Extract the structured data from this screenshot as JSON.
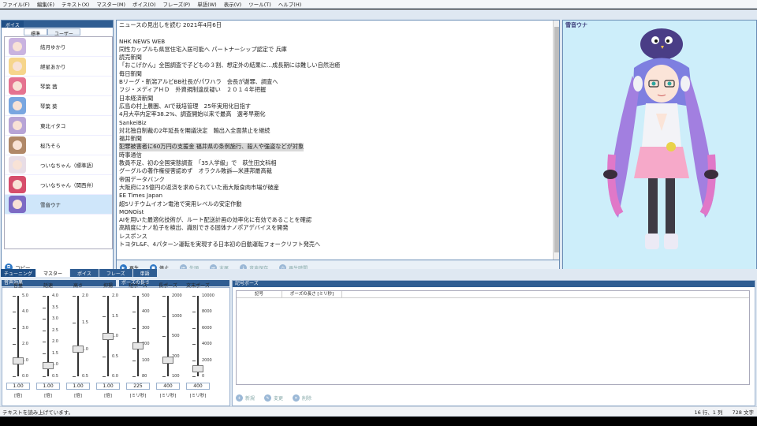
{
  "menu": [
    "ファイル(F)",
    "編集(E)",
    "テキスト(X)",
    "マスター(M)",
    "ボイス(O)",
    "フレーズ(P)",
    "単語(W)",
    "表示(V)",
    "ツール(T)",
    "ヘルプ(H)"
  ],
  "voice_panel": {
    "tabs": [
      "ボイス",
      "標準",
      "ユーザー"
    ],
    "items": [
      {
        "name": "結月ゆかり",
        "color": "#c9b3e0"
      },
      {
        "name": "紲星あかり",
        "color": "#f6d58b"
      },
      {
        "name": "琴葉 茜",
        "color": "#e57390"
      },
      {
        "name": "琴葉 葵",
        "color": "#79a6e0"
      },
      {
        "name": "東北イタコ",
        "color": "#b7a4d6"
      },
      {
        "name": "桜乃そら",
        "color": "#b08868"
      },
      {
        "name": "ついなちゃん（標準語）",
        "color": "#e8dde6"
      },
      {
        "name": "ついなちゃん（関西弁）",
        "color": "#d64d6b"
      },
      {
        "name": "雪音ウナ",
        "color": "#7c6ac4"
      }
    ],
    "selected_index": 8,
    "copy_label": "コピー"
  },
  "editor": {
    "lines": [
      "ニュースの見出しを読む 2021年4月6日",
      "",
      "NHK NEWS WEB",
      "同性カップルも県営住宅入居可能へ パートナーシップ認定で 兵庫",
      "読売新聞",
      "「おこげかん」全国調査で子どもの３割、想定外の結果に…成長期には難しい自然治癒",
      "毎日新聞",
      "Bリーグ・新潟アルビBB社長がパワハラ　会長が謝罪、調査へ",
      "フジ・メディアＨＤ　外資規制違反疑い　２０１４年把握",
      "日本経済新聞",
      "広島の村上農園、AIで栽培管理　25年実用化目指す",
      "4月大卒内定率38.2%、調査開始以来で最高　選考早期化",
      "SankeiBiz",
      "対北独自制裁の2年延長を閣議決定　輸出入全面禁止を継続",
      "福井新聞",
      "犯罪被害者に60万円の支援金 福井県の条例施行、殺人や強盗などが対象",
      "時事通信",
      "教員不足、初の全国実態調査　「35人学級」で　萩生田文科相",
      "グーグルの著作権侵害認めず　オラクル敗訴―米連邦最高裁",
      "帝国データバンク",
      "大阪府に25億円の返済を求められていた南大阪食肉市場が破産",
      "EE Times Japan",
      "超Sリチウムイオン電池で実用レベルの安定作動",
      "MONOist",
      "AIを用いた最適化技術が、ルート配送計画の効率化に有効であることを確認",
      "高精度にナノ粒子を検出、識別できる固体ナノポアデバイスを開発",
      "レスポンス",
      "トヨタL&F、4パターン運転を実現する日本初の自動運転フォークリフト発売へ"
    ],
    "highlight_index": 15
  },
  "playbar": {
    "play": "再生",
    "stop": "停止",
    "start": "先頭",
    "end": "末尾",
    "save": "音声保存",
    "duration": "再生時間"
  },
  "character": {
    "name": "雪音ウナ"
  },
  "tuning": {
    "tabs": [
      "チューニング",
      "マスター",
      "ボイス",
      "フレーズ",
      "単語"
    ],
    "active_tab": "マスター",
    "effects_title": "音声効果",
    "pause_title": "ポーズの長さ",
    "sliders": [
      {
        "label": "音量",
        "value": "1.00",
        "unit": "[倍]",
        "ticks": [
          "5.0",
          "4.0",
          "3.0",
          "2.0",
          "1.0",
          "0.0"
        ],
        "pos": 0.8
      },
      {
        "label": "話速",
        "value": "1.00",
        "unit": "[倍]",
        "ticks": [
          "4.0",
          "3.5",
          "3.0",
          "2.5",
          "2.0",
          "1.5",
          "1.0",
          "0.5"
        ],
        "pos": 0.86
      },
      {
        "label": "高さ",
        "value": "1.00",
        "unit": "[倍]",
        "ticks": [
          "2.0",
          "1.5",
          "1.0",
          "0.5"
        ],
        "pos": 0.66
      },
      {
        "label": "抑揚",
        "value": "1.00",
        "unit": "[倍]",
        "ticks": [
          "2.0",
          "1.5",
          "1.0",
          "0.5",
          "0.0"
        ],
        "pos": 0.5
      },
      {
        "label": "短ポーズ",
        "value": "225",
        "unit": "[ミリ秒]",
        "ticks": [
          "500",
          "400",
          "300",
          "200",
          "100",
          "80"
        ],
        "pos": 0.62
      },
      {
        "label": "長ポーズ",
        "value": "400",
        "unit": "[ミリ秒]",
        "ticks": [
          "2000",
          "1000",
          "500",
          "200",
          "100"
        ],
        "pos": 0.79
      },
      {
        "label": "文末ポーズ",
        "value": "400",
        "unit": "[ミリ秒]",
        "ticks": [
          "10000",
          "8000",
          "6000",
          "4000",
          "2000",
          "0"
        ],
        "pos": 0.9
      }
    ],
    "pause_panel": {
      "title": "記号ポーズ",
      "col_symbol": "記号",
      "col_length": "ポーズの長さ [ミリ秒]",
      "btn_new": "新規",
      "btn_edit": "変更",
      "btn_delete": "削除"
    }
  },
  "status": {
    "message": "テキストを読み上げています。",
    "position": "16 行、1 列",
    "chars": "728 文字"
  }
}
